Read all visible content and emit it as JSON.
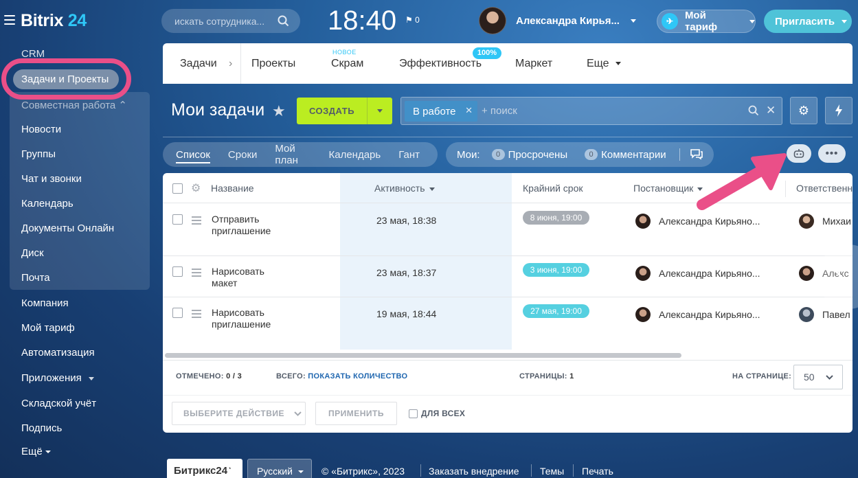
{
  "header": {
    "logo_main": "Bitrix",
    "logo_num": "24",
    "search_placeholder": "искать сотрудника...",
    "time": "18:40",
    "flag_count": "0",
    "user_name": "Александра Кирья...",
    "tariff_label": "Мой тариф",
    "invite_label": "Пригласить"
  },
  "sidebar": {
    "items": [
      {
        "label": "CRM"
      },
      {
        "label": "Задачи и Проекты"
      },
      {
        "label": "Совместная работа"
      },
      {
        "label": "Новости"
      },
      {
        "label": "Группы"
      },
      {
        "label": "Чат и звонки"
      },
      {
        "label": "Календарь"
      },
      {
        "label": "Документы Онлайн"
      },
      {
        "label": "Диск"
      },
      {
        "label": "Почта"
      },
      {
        "label": "Компания"
      },
      {
        "label": "Мой тариф"
      },
      {
        "label": "Автоматизация"
      },
      {
        "label": "Приложения"
      },
      {
        "label": "Складской учёт"
      },
      {
        "label": "Подпись"
      },
      {
        "label": "Ещё"
      }
    ]
  },
  "nav": {
    "tabs": [
      {
        "label": "Задачи"
      },
      {
        "label": "Проекты"
      },
      {
        "label": "Скрам"
      },
      {
        "label": "Эффективность"
      },
      {
        "label": "Маркет"
      },
      {
        "label": "Еще"
      }
    ],
    "new_badge": "НОВОЕ",
    "efficiency_badge": "100%"
  },
  "toolbar": {
    "title": "Мои задачи",
    "create_label": "СОЗДАТЬ",
    "filter_chip": "В работе",
    "search_placeholder": "+ поиск"
  },
  "views": {
    "items": [
      {
        "label": "Список"
      },
      {
        "label": "Сроки"
      },
      {
        "label": "Мой план"
      },
      {
        "label": "Календарь"
      },
      {
        "label": "Гант"
      }
    ],
    "active": "Список"
  },
  "counters": {
    "prefix": "Мои:",
    "overdue_count": "0",
    "overdue_label": "Просрочены",
    "comments_count": "0",
    "comments_label": "Комментарии"
  },
  "grid": {
    "columns": [
      "Название",
      "Активность",
      "Крайний срок",
      "Постановщик",
      "Ответственн"
    ],
    "rows": [
      {
        "name_line1": "Отправить",
        "name_line2": "приглашение",
        "activity": "23 мая, 18:38",
        "deadline": "8 июня, 19:00",
        "deadline_color": "#a8adb4",
        "creator": "Александра Кирьяно...",
        "responsible": "Михаи"
      },
      {
        "name_line1": "Нарисовать",
        "name_line2": "макет",
        "activity": "23 мая, 18:37",
        "deadline": "3 июня, 19:00",
        "deadline_color": "#55d0e0",
        "creator": "Александра Кирьяно...",
        "responsible": "Алекс"
      },
      {
        "name_line1": "Нарисовать",
        "name_line2": "приглашение",
        "activity": "19 мая, 18:44",
        "deadline": "27 мая, 19:00",
        "deadline_color": "#55d0e0",
        "creator": "Александра Кирьяно...",
        "responsible": "Павел"
      }
    ],
    "selected_label": "ОТМЕЧЕНО:",
    "selected_value": "0 / 3",
    "total_label": "ВСЕГО:",
    "total_link": "ПОКАЗАТЬ КОЛИЧЕСТВО",
    "pages_label": "СТРАНИЦЫ:",
    "pages_value": "1",
    "per_page_label": "НА СТРАНИЦЕ:",
    "per_page_value": "50",
    "action_select": "ВЫБЕРИТЕ ДЕЙСТВИЕ",
    "apply_label": "ПРИМЕНИТЬ",
    "for_all_label": "ДЛЯ ВСЕХ"
  },
  "footer": {
    "brand": "Битрикс24",
    "language": "Русский",
    "copyright": "© «Битрикс», 2023",
    "links": [
      "Заказать внедрение",
      "Темы",
      "Печать"
    ]
  },
  "colors": {
    "accent_pink": "#ea4f88",
    "create_green": "#bbed21",
    "invite_teal": "#4fc3d8"
  }
}
